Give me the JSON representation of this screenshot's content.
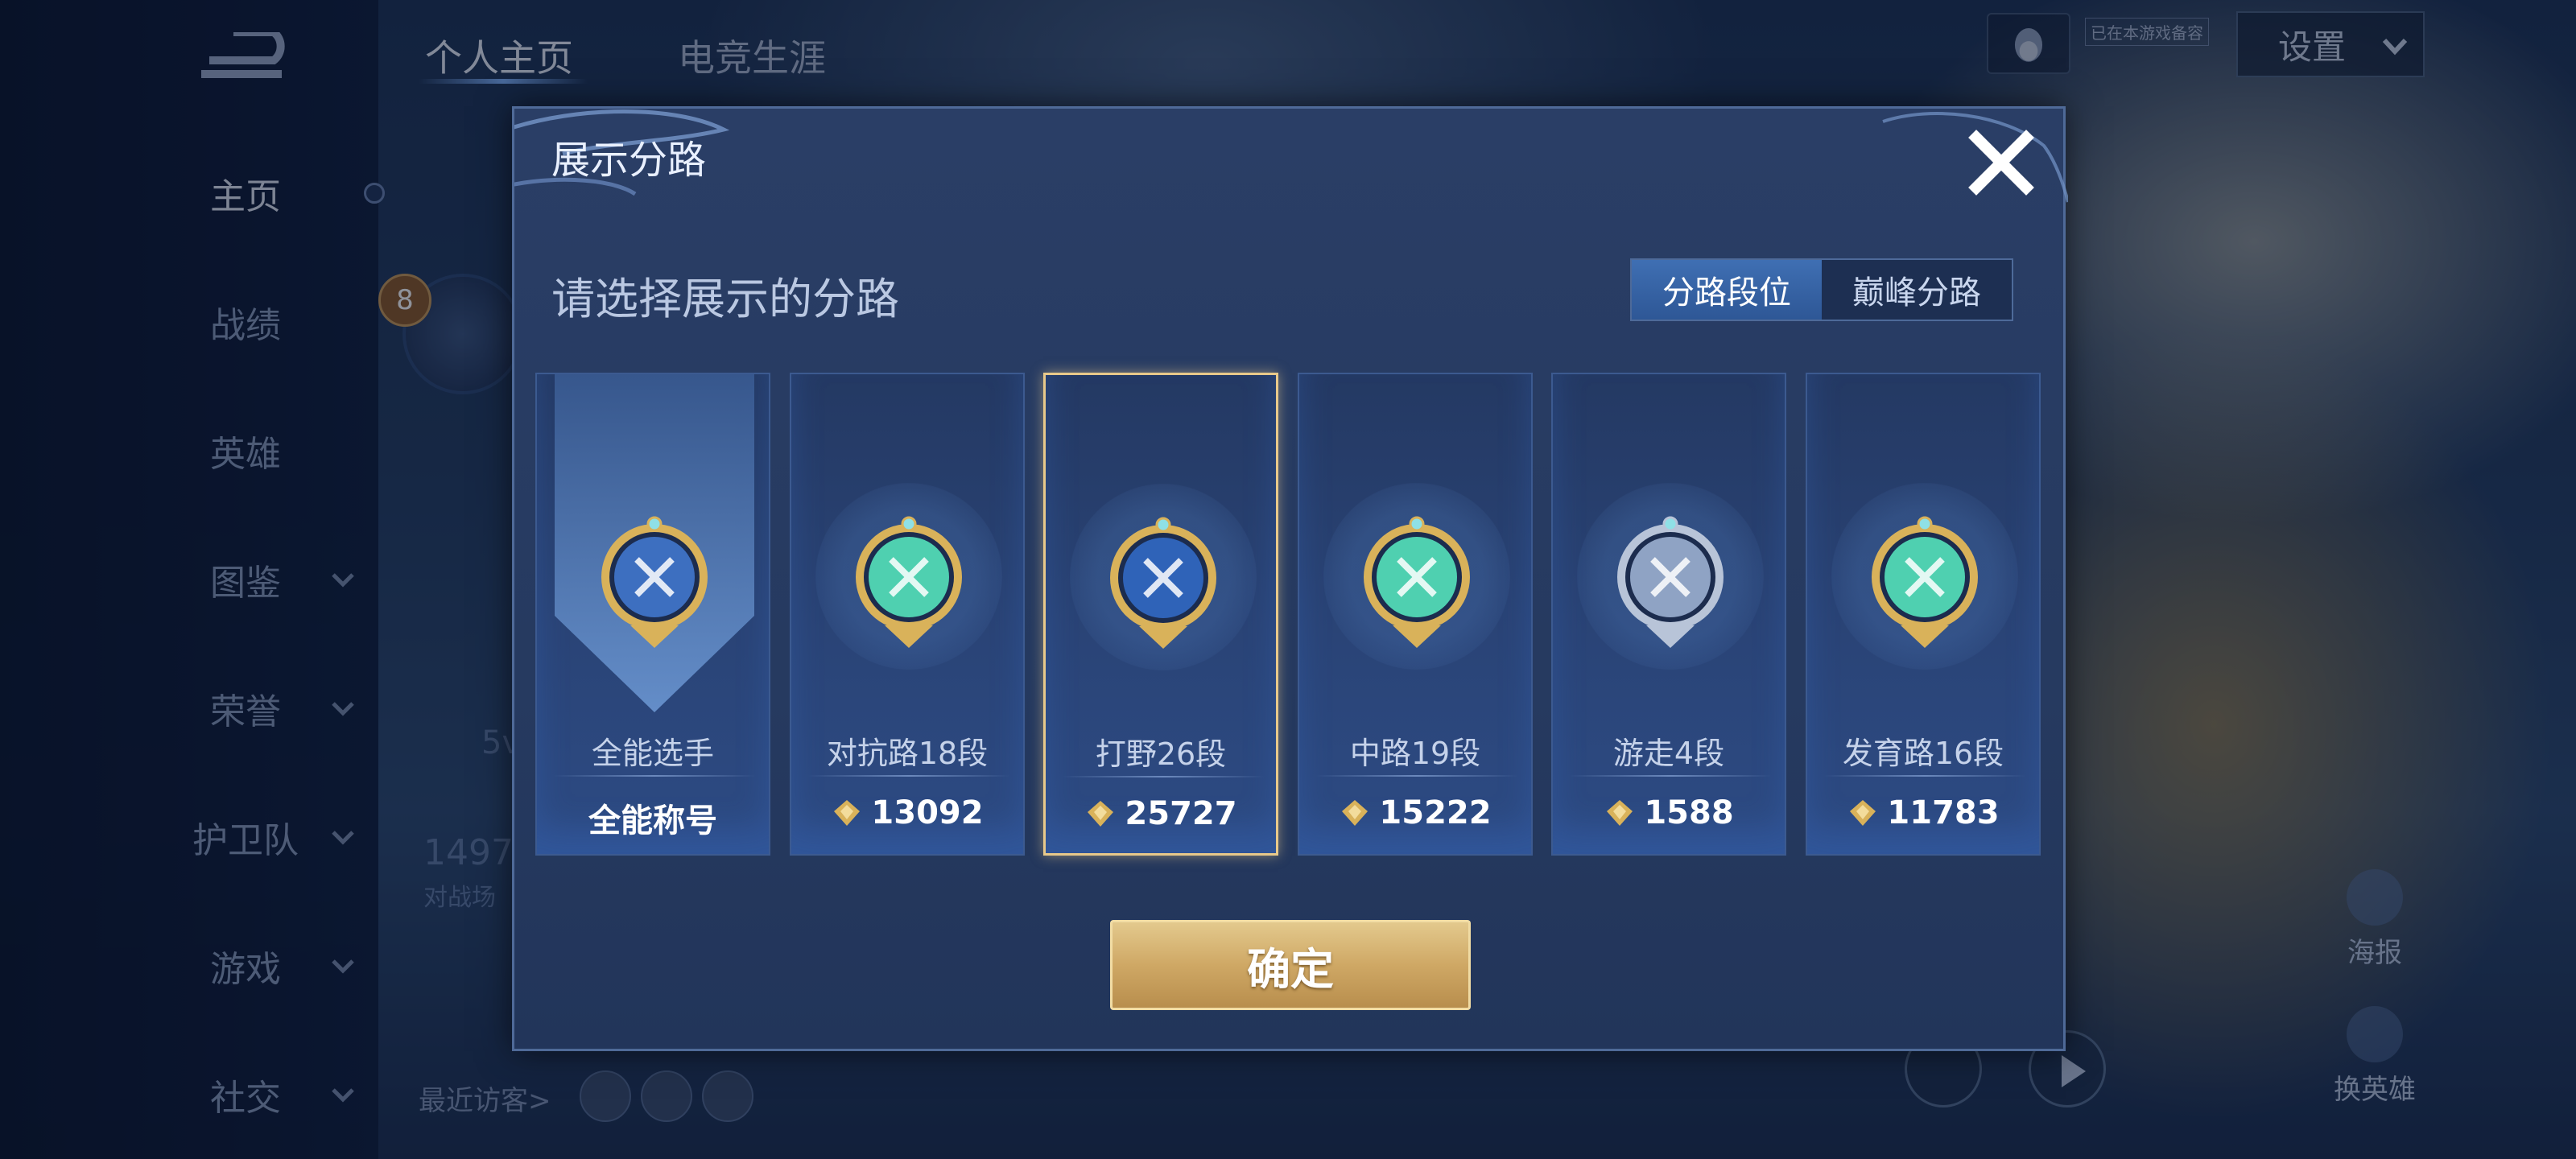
{
  "nav": {
    "items": [
      {
        "label": "主页",
        "active": true,
        "has_chevron": false
      },
      {
        "label": "战绩",
        "has_chevron": false
      },
      {
        "label": "英雄",
        "has_chevron": false
      },
      {
        "label": "图鉴",
        "has_chevron": true
      },
      {
        "label": "荣誉",
        "has_chevron": true
      },
      {
        "label": "护卫队",
        "has_chevron": true
      },
      {
        "label": "游戏",
        "has_chevron": true
      },
      {
        "label": "社交",
        "has_chevron": true
      }
    ]
  },
  "top_tabs": [
    {
      "label": "个人主页",
      "active": true
    },
    {
      "label": "电竞生涯",
      "active": false
    }
  ],
  "top_right": {
    "settings_label": "设置",
    "small_label": "已在本游戏备容"
  },
  "background": {
    "level": "8",
    "partial_text_1": "5v",
    "partial_number": "1497",
    "partial_text_2": "对战场",
    "recent_visitors_label": "最近访客>",
    "poster_label": "海报",
    "change_hero_label": "换英雄"
  },
  "modal": {
    "title": "展示分路",
    "subtitle": "请选择展示的分路",
    "toggle": [
      {
        "label": "分路段位",
        "active": true
      },
      {
        "label": "巅峰分路",
        "active": false
      }
    ],
    "cards": [
      {
        "name": "全能选手",
        "value": "全能称号",
        "type": "allround",
        "badge_color": "#3d6fc0",
        "selected": false
      },
      {
        "name": "对抗路18段",
        "value": "13092",
        "type": "clash",
        "badge_color": "#4fd0b0",
        "selected": false
      },
      {
        "name": "打野26段",
        "value": "25727",
        "type": "jungle",
        "badge_color": "#2f63b8",
        "selected": true
      },
      {
        "name": "中路19段",
        "value": "15222",
        "type": "mid",
        "badge_color": "#4fd0b0",
        "selected": false
      },
      {
        "name": "游走4段",
        "value": "1588",
        "type": "roam",
        "badge_color": "#8fa3c4",
        "selected": false
      },
      {
        "name": "发育路16段",
        "value": "11783",
        "type": "farm",
        "badge_color": "#4fd0b0",
        "selected": false
      }
    ],
    "confirm_label": "确定"
  },
  "colors": {
    "accent_gold": "#e3c98d",
    "selected_border": "#e8c98a",
    "toggle_active": "#3f6fb3",
    "modal_bg": "#2a3e66"
  }
}
